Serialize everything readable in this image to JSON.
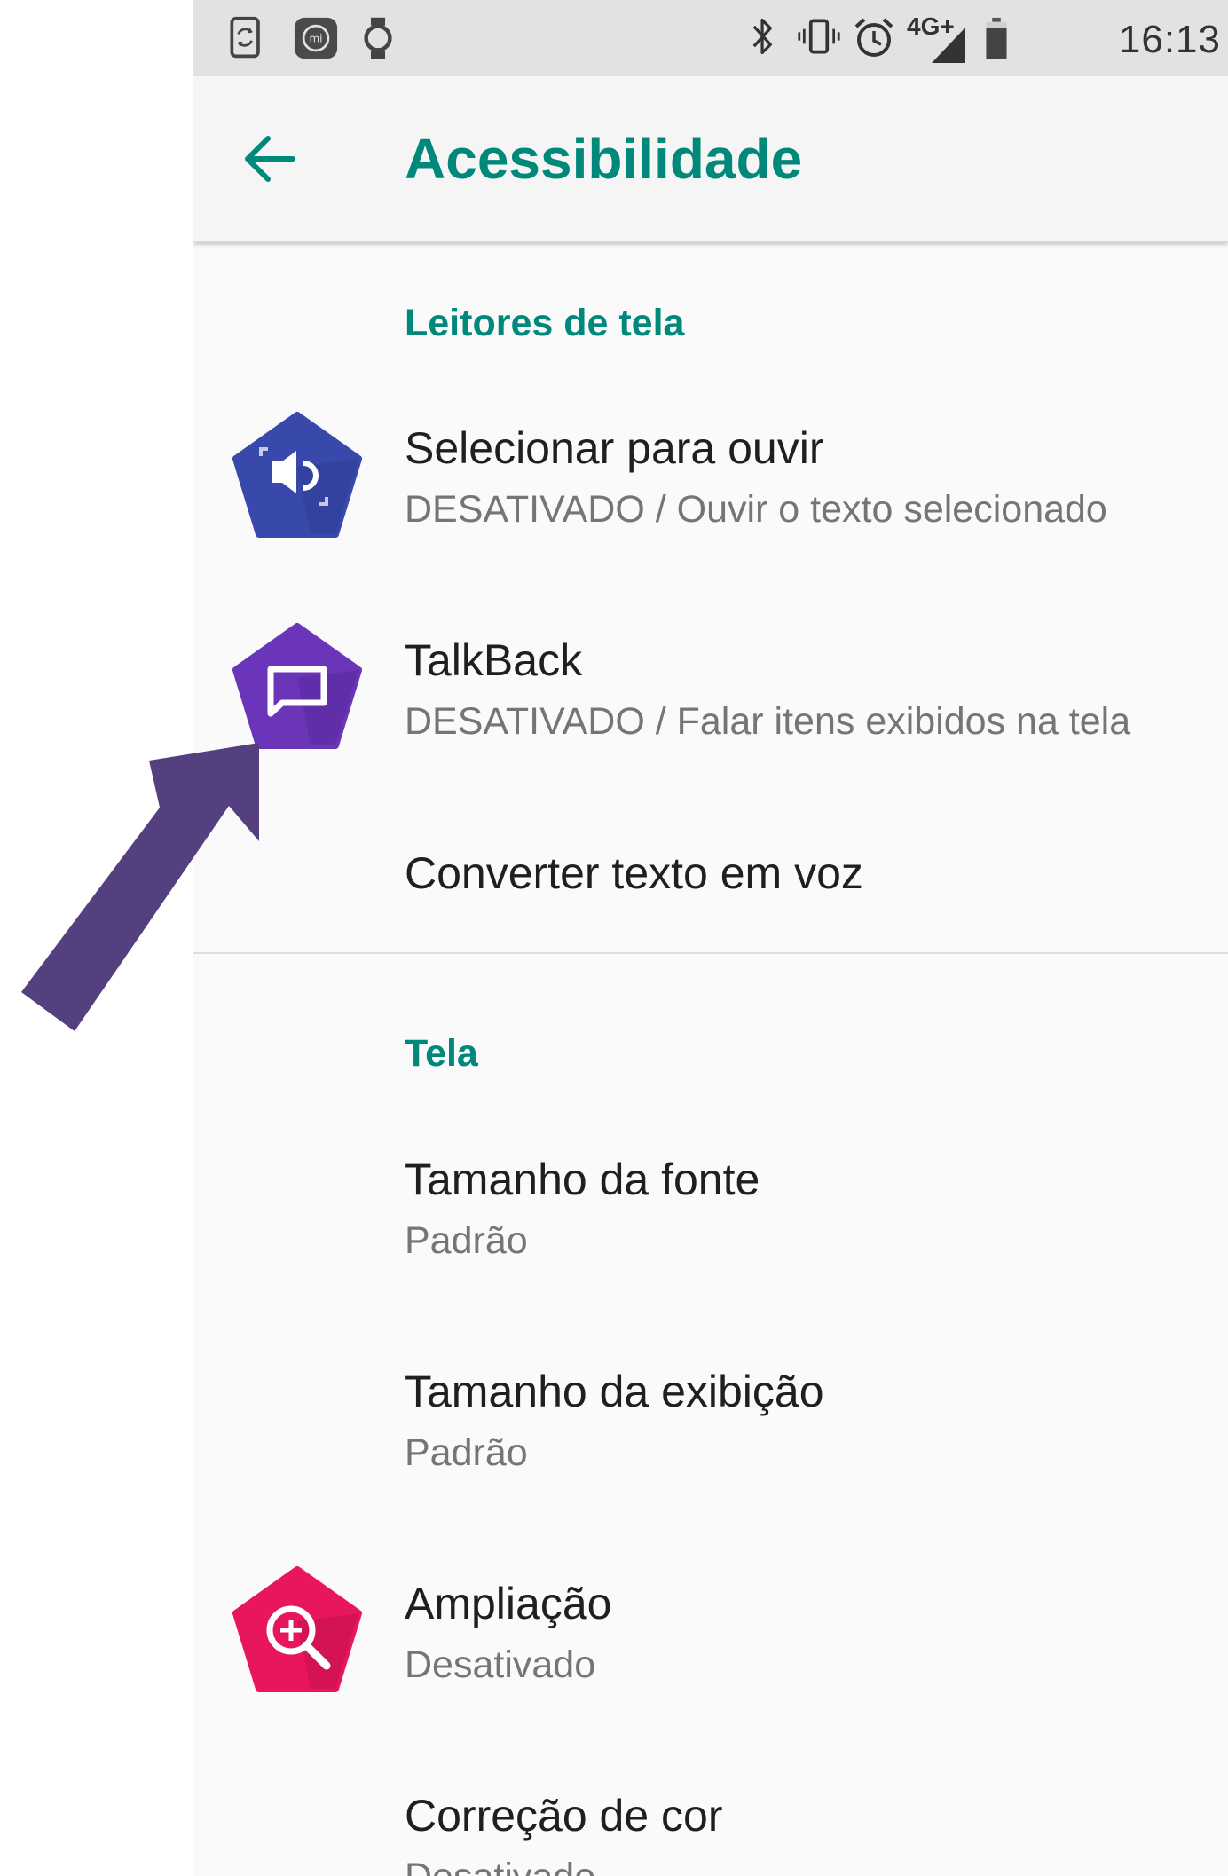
{
  "status_bar": {
    "time": "16:13",
    "network": "4G+",
    "left_icons": [
      "phone-sync-icon",
      "mi-app-icon",
      "watch-icon"
    ],
    "right_icons": [
      "bluetooth-icon",
      "vibrate-icon",
      "alarm-icon",
      "signal-icon",
      "battery-icon"
    ]
  },
  "app_bar": {
    "title": "Acessibilidade",
    "back_icon": "arrow-left-icon"
  },
  "colors": {
    "accent": "#00897b",
    "select_to_speak": "#3949ab",
    "talkback": "#6a35b8",
    "magnification": "#e8175d",
    "annotation_arrow": "#55407f"
  },
  "sections": [
    {
      "header": "Leitores de tela",
      "items": [
        {
          "title": "Selecionar para ouvir",
          "subtitle": "DESATIVADO / Ouvir o texto selecionado",
          "icon": "select-to-speak-icon"
        },
        {
          "title": "TalkBack",
          "subtitle": "DESATIVADO / Falar itens exibidos na tela",
          "icon": "talkback-icon"
        },
        {
          "title": "Converter texto em voz"
        }
      ]
    },
    {
      "header": "Tela",
      "items": [
        {
          "title": "Tamanho da fonte",
          "subtitle": "Padrão"
        },
        {
          "title": "Tamanho da exibição",
          "subtitle": "Padrão"
        },
        {
          "title": "Ampliação",
          "subtitle": "Desativado",
          "icon": "magnification-icon"
        },
        {
          "title": "Correção de cor",
          "subtitle": "Desativado"
        }
      ]
    }
  ]
}
